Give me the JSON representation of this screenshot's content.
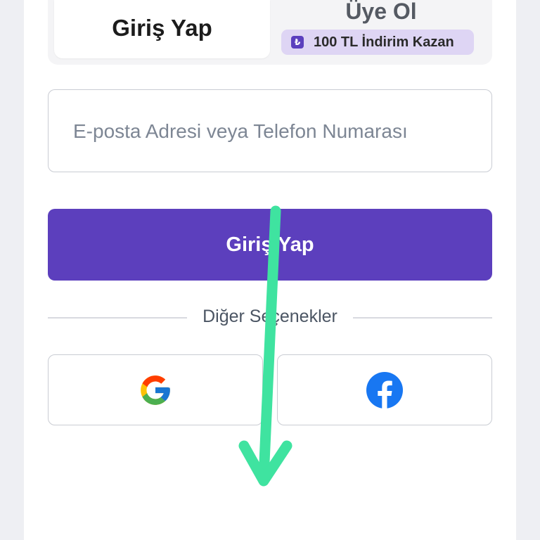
{
  "tabs": {
    "login_label": "Giriş Yap",
    "signup_label": "Üye Ol",
    "promo_icon": "₺",
    "promo_text": "100 TL İndirim Kazan"
  },
  "form": {
    "identifier_placeholder": "E-posta Adresi veya Telefon Numarası",
    "identifier_value": "",
    "submit_label": "Giriş Yap"
  },
  "other_options": {
    "label": "Diğer Seçenekler",
    "providers": [
      {
        "name": "google",
        "icon": "google-icon"
      },
      {
        "name": "facebook",
        "icon": "facebook-icon"
      }
    ]
  },
  "overlay": {
    "gesture": "swipe-down-arrow",
    "color": "#3fe3a0"
  },
  "colors": {
    "accent": "#5c3fbd",
    "promo_bg": "#ded5f4",
    "page_bg": "#eeeff3"
  }
}
